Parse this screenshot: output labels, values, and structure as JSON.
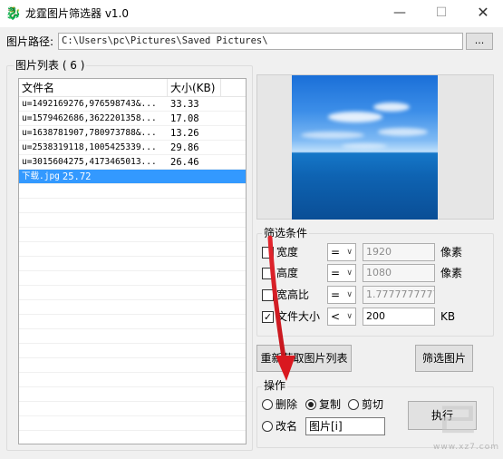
{
  "window": {
    "title": "龙霆图片筛选器 v1.0",
    "minimize_symbol": "—",
    "maximize_symbol": "☐",
    "close_symbol": "✕"
  },
  "path": {
    "label": "图片路径:",
    "value": "C:\\Users\\pc\\Pictures\\Saved Pictures\\",
    "browse_label": "..."
  },
  "image_list": {
    "title": "图片列表 ( 6 )",
    "columns": [
      "文件名",
      "大小(KB)"
    ],
    "rows": [
      {
        "name": "u=1492169276,976598743&...",
        "size": "33.33"
      },
      {
        "name": "u=1579462686,3622201358...",
        "size": "17.08"
      },
      {
        "name": "u=1638781907,780973788&...",
        "size": "13.26"
      },
      {
        "name": "u=2538319118,1005425339...",
        "size": "29.86"
      },
      {
        "name": "u=3015604275,4173465013...",
        "size": "26.46"
      },
      {
        "name": "下载.jpg",
        "size": "25.72"
      }
    ],
    "selected_index": 5
  },
  "filter": {
    "title": "筛选条件",
    "rows": [
      {
        "label": "宽度",
        "checked": false,
        "op": "=",
        "value": "1920",
        "unit": "像素",
        "enabled": false
      },
      {
        "label": "高度",
        "checked": false,
        "op": "=",
        "value": "1080",
        "unit": "像素",
        "enabled": false
      },
      {
        "label": "宽高比",
        "checked": false,
        "op": "=",
        "value": "1.7777777777",
        "unit": "",
        "enabled": false
      },
      {
        "label": "文件大小",
        "checked": true,
        "op": "<",
        "value": "200",
        "unit": "KB",
        "enabled": true
      }
    ],
    "check_mark": "✓",
    "dropdown_arrow": "∨"
  },
  "buttons": {
    "reload": "重新获取图片列表",
    "filter": "筛选图片",
    "execute": "执行"
  },
  "operation": {
    "title": "操作",
    "options": [
      {
        "label": "删除",
        "selected": false
      },
      {
        "label": "复制",
        "selected": true
      },
      {
        "label": "剪切",
        "selected": false
      },
      {
        "label": "改名",
        "selected": false
      }
    ],
    "rename_value": "图片[i]"
  },
  "icons": {
    "app": "app-logo-icon"
  },
  "colors": {
    "selection": "#3399ff",
    "annotation_arrow": "#d9181f"
  }
}
